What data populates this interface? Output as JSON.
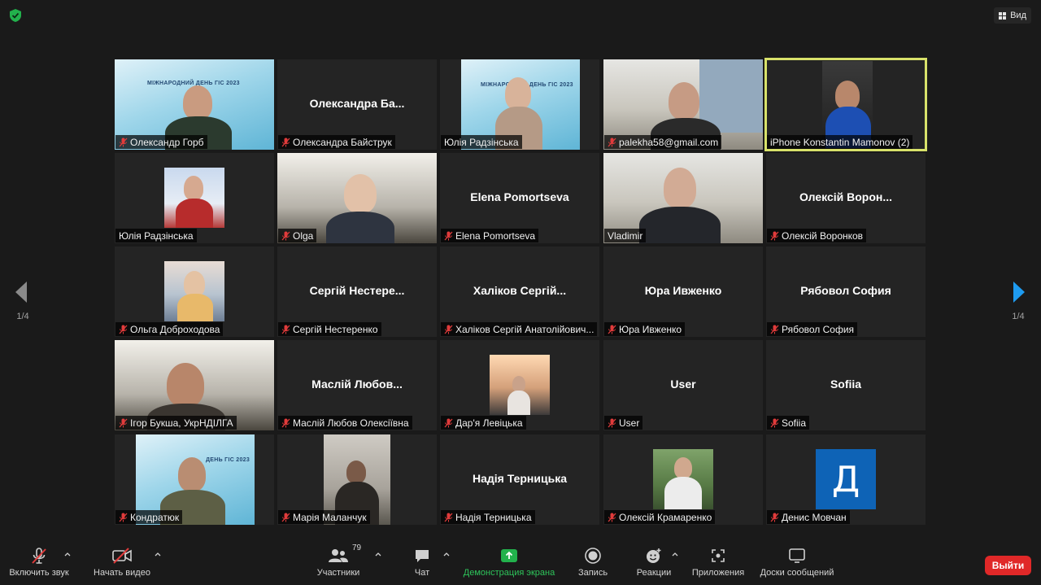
{
  "top": {
    "view_label": "Вид"
  },
  "pager": {
    "left": "1/4",
    "right": "1/4"
  },
  "tiles": [
    {
      "label": "Олександр Горб",
      "muted": true
    },
    {
      "label": "Олександра Байструк",
      "muted": true,
      "bigname": "Олександра Ба..."
    },
    {
      "label": "Юлія Радзінська",
      "muted": false
    },
    {
      "label": "palekha58@gmail.com",
      "muted": true
    },
    {
      "label": "iPhone Konstantin Mamonov (2)",
      "muted": false
    },
    {
      "label": "Юлія Радзінська",
      "muted": false
    },
    {
      "label": "Olga",
      "muted": true
    },
    {
      "label": "Elena Pomortseva",
      "muted": true,
      "bigname": "Elena Pomortseva"
    },
    {
      "label": "Vladimir",
      "muted": false
    },
    {
      "label": "Олексій Воронков",
      "muted": true,
      "bigname": "Олексій Ворон..."
    },
    {
      "label": "Ольга Доброходова",
      "muted": true
    },
    {
      "label": "Сергій Нестеренко",
      "muted": true,
      "bigname": "Сергій Нестере..."
    },
    {
      "label": "Халіков Сергій Анатолійович...",
      "muted": true,
      "bigname": "Халіков Сергій..."
    },
    {
      "label": "Юра Ивженко",
      "muted": true,
      "bigname": "Юра Ивженко"
    },
    {
      "label": "Рябовол София",
      "muted": true,
      "bigname": "Рябовол София"
    },
    {
      "label": "Ігор Букша, УкрНДІЛГА",
      "muted": true
    },
    {
      "label": "Маслій Любов Олексіївна",
      "muted": true,
      "bigname": "Маслій Любов..."
    },
    {
      "label": "Дар'я Левіцька",
      "muted": true
    },
    {
      "label": "User",
      "muted": true,
      "bigname": "User"
    },
    {
      "label": "Sofiia",
      "muted": true,
      "bigname": "Sofiia"
    },
    {
      "label": "Кондратюк",
      "muted": true
    },
    {
      "label": "Марія Маланчук",
      "muted": true
    },
    {
      "label": "Надія Терницька",
      "muted": true,
      "bigname": "Надія Терницька"
    },
    {
      "label": "Олексій Крамаренко",
      "muted": true
    },
    {
      "label": "Денис Мовчан",
      "muted": true,
      "avatar_letter": "Д"
    }
  ],
  "slide_title": "МІЖНАРОДНИЙ ДЕНЬ ГІС 2023",
  "slide_title_short": "ДЕНЬ ГІС 2023",
  "toolbar": {
    "audio": "Включить звук",
    "video": "Начать видео",
    "participants": "Участники",
    "participants_count": "79",
    "chat": "Чат",
    "share": "Демонстрация экрана",
    "record": "Запись",
    "reactions": "Реакции",
    "apps": "Приложения",
    "whiteboards": "Доски сообщений",
    "leave": "Выйти"
  },
  "colors": {
    "accent_green": "#2ec45a",
    "leave_red": "#e02828",
    "active_border": "#d8e26a",
    "avatar_blue": "#0e63b6"
  }
}
